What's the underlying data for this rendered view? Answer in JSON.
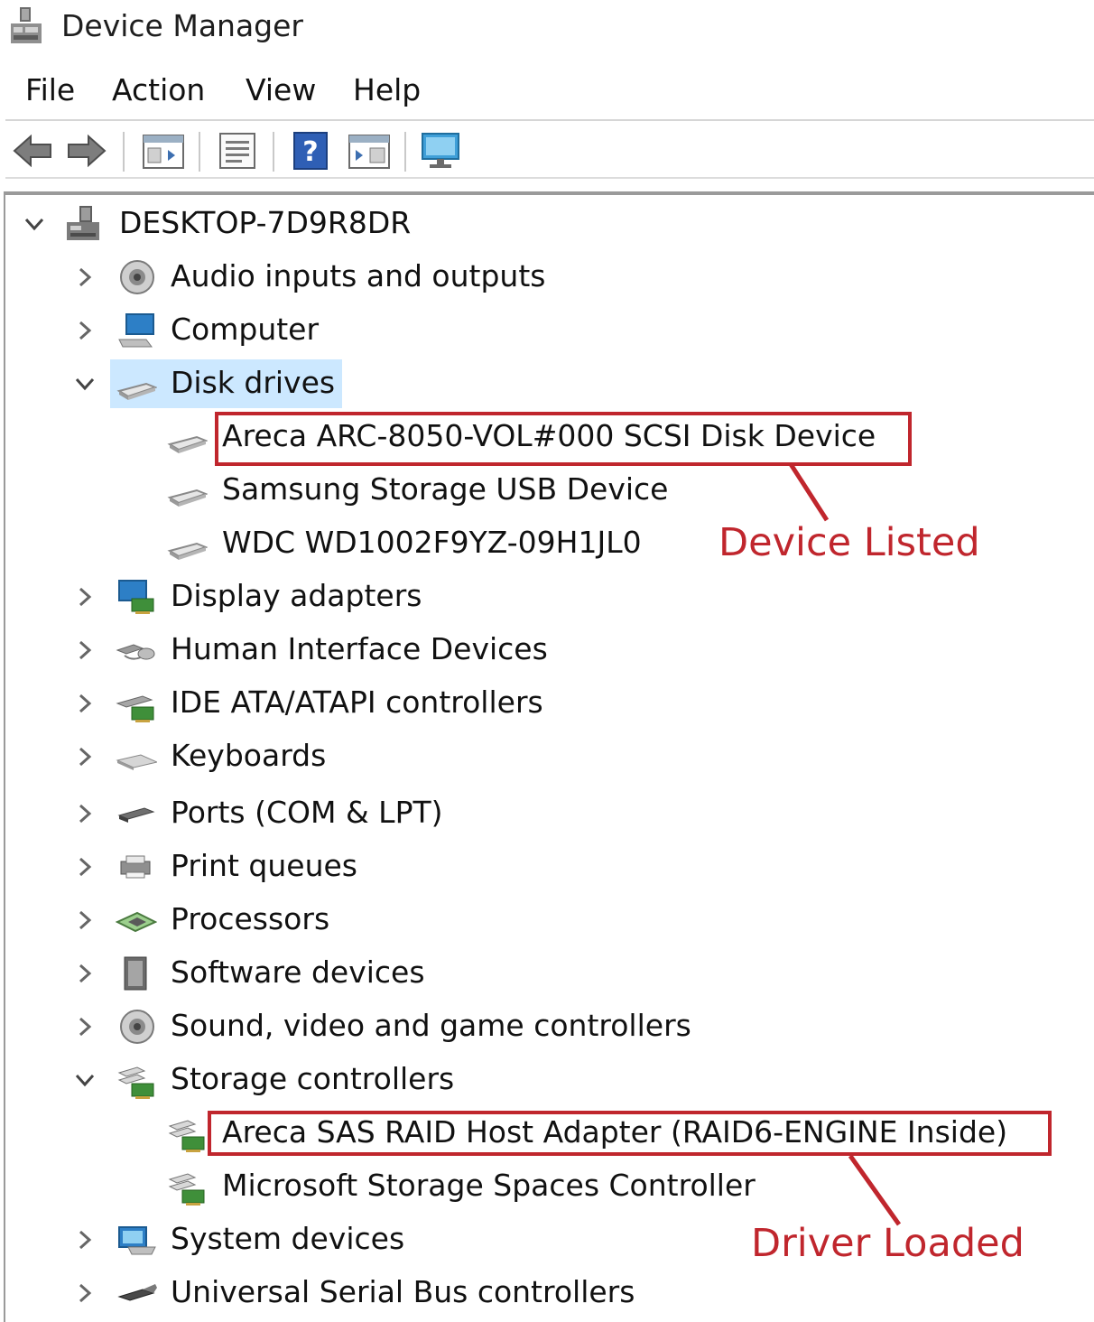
{
  "window": {
    "title": "Device Manager"
  },
  "menu": {
    "file": "File",
    "action": "Action",
    "view": "View",
    "help": "Help"
  },
  "toolbar": {
    "icons": [
      "back-arrow-icon",
      "forward-arrow-icon",
      "show-hide-console-tree-icon",
      "properties-icon",
      "help-icon",
      "action-pane-icon",
      "scan-hardware-icon"
    ]
  },
  "tree": {
    "root": "DESKTOP-7D9R8DR",
    "categories": {
      "audio": "Audio inputs and outputs",
      "computer": "Computer",
      "disk_drives": "Disk drives",
      "display": "Display adapters",
      "hid": "Human Interface Devices",
      "ide": "IDE ATA/ATAPI controllers",
      "keyboards": "Keyboards",
      "ports": "Ports (COM & LPT)",
      "print": "Print queues",
      "processors": "Processors",
      "software": "Software devices",
      "sound": "Sound, video and game controllers",
      "storage": "Storage controllers",
      "system": "System devices",
      "usb": "Universal Serial Bus controllers"
    },
    "disk_children": [
      "Areca ARC-8050-VOL#000 SCSI Disk Device",
      "Samsung Storage USB Device",
      "WDC WD1002F9YZ-09H1JL0"
    ],
    "storage_children": [
      "Areca SAS RAID Host Adapter (RAID6-ENGINE Inside)",
      "Microsoft Storage Spaces Controller"
    ],
    "selected": "Disk drives"
  },
  "annotations": {
    "device_listed": "Device Listed",
    "driver_loaded": "Driver Loaded",
    "color": "#c0262d"
  }
}
